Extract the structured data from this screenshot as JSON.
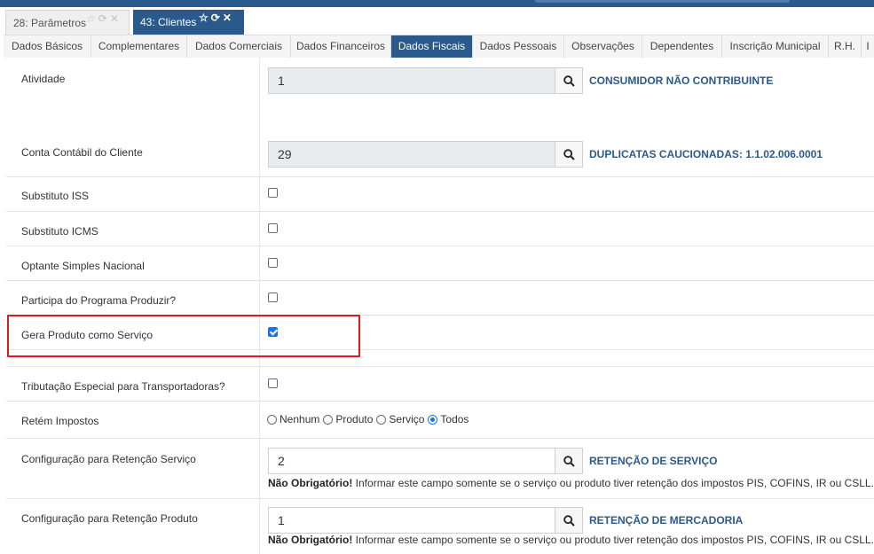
{
  "window_tabs": [
    {
      "label": "28: Parâmetros"
    },
    {
      "label": "43: Clientes"
    }
  ],
  "section_tabs": [
    {
      "label": "Dados Básicos"
    },
    {
      "label": "Complementares"
    },
    {
      "label": "Dados Comerciais"
    },
    {
      "label": "Dados Financeiros"
    },
    {
      "label": "Dados Fiscais",
      "active": true
    },
    {
      "label": "Dados Pessoais"
    },
    {
      "label": "Observações"
    },
    {
      "label": "Dependentes"
    },
    {
      "label": "Inscrição Municipal"
    },
    {
      "label": "R.H."
    }
  ],
  "form": {
    "atividade": {
      "label": "Atividade",
      "value": "1",
      "description": "CONSUMIDOR NÃO CONTRIBUINTE"
    },
    "conta_contabil": {
      "label": "Conta Contábil do Cliente",
      "value": "29",
      "description": "DUPLICATAS CAUCIONADAS: 1.1.02.006.0001"
    },
    "substituto_iss": {
      "label": "Substituto ISS",
      "checked": false
    },
    "substituto_icms": {
      "label": "Substituto ICMS",
      "checked": false
    },
    "optante_simples": {
      "label": "Optante Simples Nacional",
      "checked": false
    },
    "programa_produzir": {
      "label": "Participa do Programa Produzir?",
      "checked": false
    },
    "gera_produto_servico": {
      "label": "Gera Produto como Serviço",
      "checked": true
    },
    "tributacao_especial": {
      "label": "Tributação Especial para Transportadoras?",
      "checked": false
    },
    "retem_impostos": {
      "label": "Retém Impostos",
      "options": [
        "Nenhum",
        "Produto",
        "Serviço",
        "Todos"
      ],
      "selected": "Todos"
    },
    "retencao_servico": {
      "label": "Configuração para Retenção Serviço",
      "value": "2",
      "description": "RETENÇÃO DE SERVIÇO",
      "note_bold": "Não Obrigatório!",
      "note_text": " Informar este campo somente se o serviço ou produto tiver retenção dos impostos PIS, COFINS, IR ou CSLL. O s"
    },
    "retencao_produto": {
      "label": "Configuração para Retenção Produto",
      "value": "1",
      "description": "RETENÇÃO DE MERCADORIA",
      "note_bold": "Não Obrigatório!",
      "note_text": " Informar este campo somente se o serviço ou produto tiver retenção dos impostos PIS, COFINS, IR ou CSLL. O s"
    }
  },
  "colors": {
    "accent": "#2a5a8c",
    "highlight": "#e01a1a",
    "checkbox": "#1a73e8"
  }
}
